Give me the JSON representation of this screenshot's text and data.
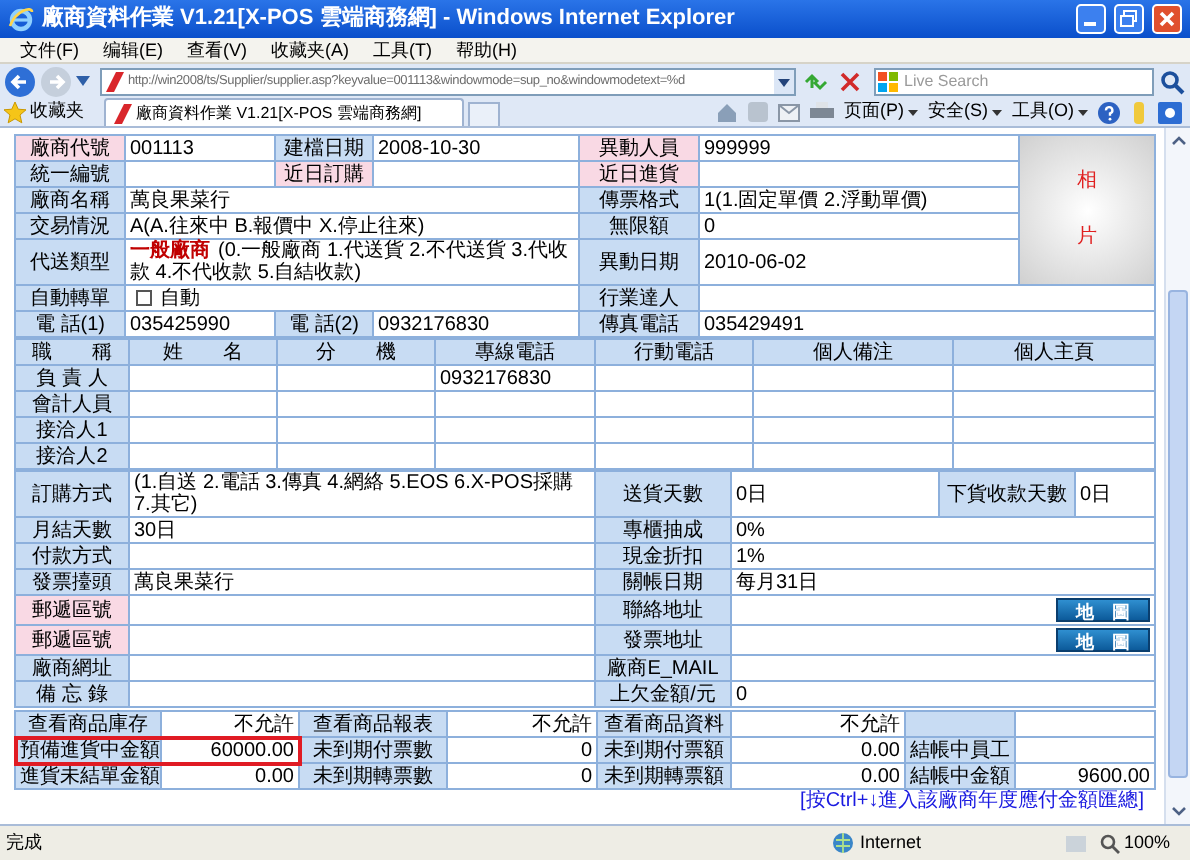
{
  "window": {
    "title": "廠商資料作業 V1.21[X-POS 雲端商務網] - Windows Internet Explorer"
  },
  "menu": [
    "文件(F)",
    "编辑(E)",
    "查看(V)",
    "收藏夹(A)",
    "工具(T)",
    "帮助(H)"
  ],
  "address": {
    "value": "http://win2008/ts/Supplier/supplier.asp?keyvalue=001113&windowmode=sup_no&windowmodetext=%d"
  },
  "search": {
    "placeholder": "Live Search"
  },
  "favorites": {
    "label": "收藏夹"
  },
  "tab": {
    "title": "廠商資料作業 V1.21[X-POS 雲端商務網]"
  },
  "command_bar": [
    "页面(P)",
    "安全(S)",
    "工具(O)"
  ],
  "profile": {
    "photo": "相片",
    "rows": [
      [
        {
          "kind": "label",
          "text": "廠商代號",
          "color": "#f9d9e4"
        },
        {
          "kind": "value",
          "text": "001113"
        },
        {
          "kind": "label",
          "text": "建檔日期",
          "color": "#c8dcf3"
        },
        {
          "kind": "value",
          "text": "2008-10-30"
        },
        {
          "kind": "label",
          "text": "異動人員",
          "color": "#f9d9e4"
        },
        {
          "kind": "value",
          "text": "999999"
        }
      ],
      [
        {
          "kind": "label",
          "text": "統一編號",
          "color": "#c8dcf3"
        },
        {
          "kind": "value"
        },
        {
          "kind": "label",
          "text": "近日訂購",
          "color": "#f9d9e4"
        },
        {
          "kind": "value"
        },
        {
          "kind": "label",
          "text": "近日進貨",
          "color": "#f9d9e4"
        },
        {
          "kind": "value"
        }
      ],
      [
        {
          "kind": "label",
          "text": "廠商名稱",
          "color": "#c8dcf3"
        },
        {
          "kind": "value",
          "text": "萬良果菜行",
          "colspan": 3
        },
        {
          "kind": "label",
          "text": "傳票格式",
          "color": "#c8dcf3"
        },
        {
          "kind": "value",
          "text": "1(1.固定單價 2.浮動單價)"
        }
      ],
      [
        {
          "kind": "label",
          "text": "交易情況",
          "color": "#c8dcf3"
        },
        {
          "kind": "value",
          "text": "A(A.往來中 B.報價中 X.停止往來)",
          "colspan": 3
        },
        {
          "kind": "label",
          "text": "無限額",
          "color": "#c8dcf3"
        },
        {
          "kind": "value",
          "text": "0"
        }
      ],
      [
        {
          "kind": "label",
          "text": "代送類型",
          "color": "#c8dcf3"
        },
        {
          "kind": "choice",
          "current": "一般廠商",
          "text": "(0.一般廠商 1.代送貨 2.不代送貨 3.代收款 4.不代收款 5.自結收款)",
          "colspan": 3
        },
        {
          "kind": "label",
          "text": "異動日期",
          "color": "#c8dcf3"
        },
        {
          "kind": "value",
          "text": "2010-06-02"
        }
      ],
      [
        {
          "kind": "label",
          "text": "自動轉單",
          "color": "#c8dcf3"
        },
        {
          "kind": "checkbox",
          "text": "自動",
          "checked": false,
          "colspan": 3
        },
        {
          "kind": "label",
          "text": "行業達人",
          "color": "#c8dcf3"
        },
        {
          "kind": "value",
          "colspan": 2
        }
      ],
      [
        {
          "kind": "label",
          "text": "電 話(1)",
          "color": "#c8dcf3"
        },
        {
          "kind": "value",
          "text": "035425990"
        },
        {
          "kind": "label",
          "text": "電 話(2)",
          "color": "#c8dcf3"
        },
        {
          "kind": "value",
          "text": "0932176830"
        },
        {
          "kind": "label",
          "text": "傳真電話",
          "color": "#c8dcf3"
        },
        {
          "kind": "value",
          "text": "035429491",
          "colspan": 2
        }
      ]
    ]
  },
  "contacts": {
    "columns": [
      "職　　稱",
      "姓　　名",
      "分　　機",
      "專線電話",
      "行動電話",
      "個人備注",
      "個人主頁"
    ],
    "rows": [
      {
        "title": "負 責 人",
        "direct_line": "0932176830"
      },
      {
        "title": "會計人員"
      },
      {
        "title": "接洽人1"
      },
      {
        "title": "接洽人2"
      }
    ]
  },
  "terms": {
    "rows": [
      [
        {
          "kind": "label",
          "text": "訂購方式",
          "color": "#c8dcf3"
        },
        {
          "kind": "value",
          "text": "(1.自送 2.電話 3.傳真 4.網絡 5.EOS  6.X-POS採購 7.其它)"
        },
        {
          "kind": "label",
          "text": "送貨天數",
          "color": "#c8dcf3"
        },
        {
          "kind": "value",
          "text": "0日"
        },
        {
          "kind": "label",
          "text": "下貨收款天數",
          "color": "#c8dcf3"
        },
        {
          "kind": "value",
          "text": "0日"
        }
      ],
      [
        {
          "kind": "label",
          "text": "月結天數",
          "color": "#c8dcf3"
        },
        {
          "kind": "value",
          "text": "30日"
        },
        {
          "kind": "label",
          "text": "專櫃抽成",
          "color": "#c8dcf3"
        },
        {
          "kind": "value",
          "text": "0%",
          "colspan": 3
        }
      ],
      [
        {
          "kind": "label",
          "text": "付款方式",
          "color": "#c8dcf3"
        },
        {
          "kind": "value"
        },
        {
          "kind": "label",
          "text": "現金折扣",
          "color": "#c8dcf3"
        },
        {
          "kind": "value",
          "text": "1%",
          "colspan": 3
        }
      ],
      [
        {
          "kind": "label",
          "text": "發票擡頭",
          "color": "#c8dcf3"
        },
        {
          "kind": "value",
          "text": "萬良果菜行"
        },
        {
          "kind": "label",
          "text": "關帳日期",
          "color": "#c8dcf3"
        },
        {
          "kind": "value",
          "text": "每月31日",
          "colspan": 3
        }
      ],
      [
        {
          "kind": "label",
          "text": "郵遞區號",
          "color": "#f9d9e4"
        },
        {
          "kind": "value"
        },
        {
          "kind": "label",
          "text": "聯絡地址",
          "color": "#c8dcf3"
        },
        {
          "kind": "map",
          "button": "地　圖",
          "colspan": 3
        }
      ],
      [
        {
          "kind": "label",
          "text": "郵遞區號",
          "color": "#f9d9e4"
        },
        {
          "kind": "value"
        },
        {
          "kind": "label",
          "text": "發票地址",
          "color": "#c8dcf3"
        },
        {
          "kind": "map",
          "button": "地　圖",
          "colspan": 3
        }
      ],
      [
        {
          "kind": "label",
          "text": "廠商網址",
          "color": "#c8dcf3"
        },
        {
          "kind": "value"
        },
        {
          "kind": "label",
          "text": "廠商E_MAIL",
          "color": "#c8dcf3"
        },
        {
          "kind": "value",
          "colspan": 3
        }
      ],
      [
        {
          "kind": "label",
          "text": "備 忘 錄",
          "color": "#c8dcf3"
        },
        {
          "kind": "value"
        },
        {
          "kind": "label",
          "text": "上欠金額/元",
          "color": "#c8dcf3"
        },
        {
          "kind": "value",
          "text": "0",
          "colspan": 3
        }
      ]
    ]
  },
  "summary": {
    "rows": [
      {
        "highlighted": false,
        "cells": [
          {
            "kind": "label",
            "text": "查看商品庫存",
            "color": "#c8dcf3"
          },
          {
            "kind": "value",
            "text": "不允許"
          },
          {
            "kind": "label",
            "text": "查看商品報表",
            "color": "#c8dcf3"
          },
          {
            "kind": "value",
            "text": "不允許"
          },
          {
            "kind": "label",
            "text": "查看商品資料",
            "color": "#c8dcf3"
          },
          {
            "kind": "value",
            "text": "不允許"
          },
          {
            "kind": "label",
            "color": "#c8dcf3"
          },
          {
            "kind": "value"
          }
        ]
      },
      {
        "highlighted": true,
        "cells": [
          {
            "kind": "label",
            "text": "預備進貨中金額",
            "color": "#c8dcf3"
          },
          {
            "kind": "value",
            "text": "60000.00"
          },
          {
            "kind": "label",
            "text": "未到期付票數",
            "color": "#c8dcf3"
          },
          {
            "kind": "value",
            "text": "0"
          },
          {
            "kind": "label",
            "text": "未到期付票額",
            "color": "#c8dcf3"
          },
          {
            "kind": "value",
            "text": "0.00"
          },
          {
            "kind": "label",
            "text": "結帳中員工",
            "color": "#c8dcf3"
          },
          {
            "kind": "value"
          }
        ]
      },
      {
        "highlighted": false,
        "cells": [
          {
            "kind": "label",
            "text": "進貨未結單金額",
            "color": "#c8dcf3"
          },
          {
            "kind": "value",
            "text": "0.00"
          },
          {
            "kind": "label",
            "text": "未到期轉票數",
            "color": "#c8dcf3"
          },
          {
            "kind": "value",
            "text": "0"
          },
          {
            "kind": "label",
            "text": "未到期轉票額",
            "color": "#c8dcf3"
          },
          {
            "kind": "value",
            "text": "0.00"
          },
          {
            "kind": "label",
            "text": "結帳中金額",
            "color": "#c8dcf3"
          },
          {
            "kind": "value",
            "text": "9600.00"
          }
        ]
      }
    ],
    "link": "[按Ctrl+↓進入該廠商年度應付金額匯總]"
  },
  "status_bar": {
    "text": "完成",
    "zone": "Internet",
    "zoom": "100%"
  }
}
